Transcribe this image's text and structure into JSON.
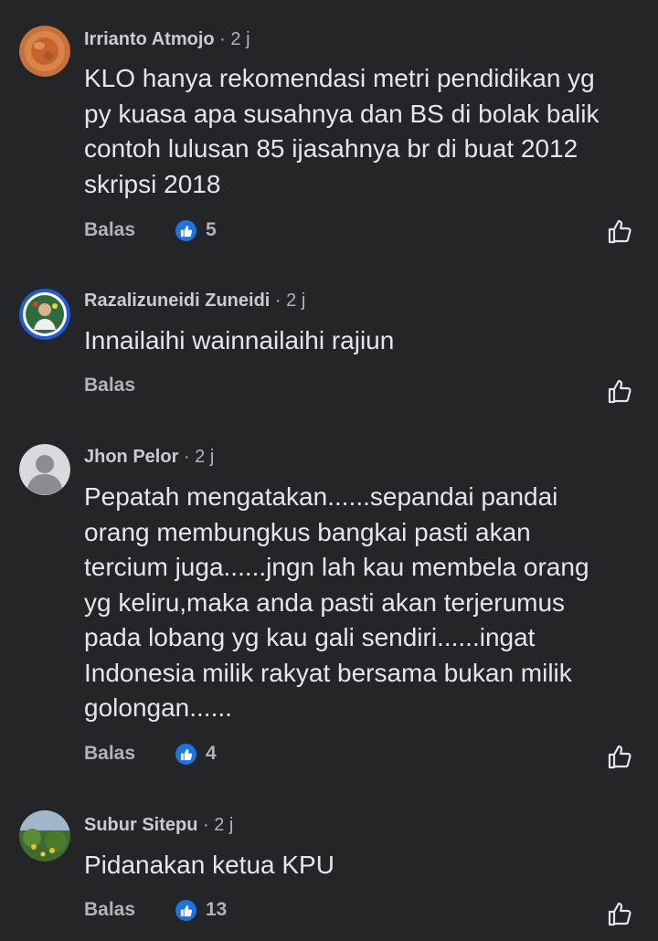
{
  "comments": [
    {
      "author": "Irrianto Atmojo",
      "time": "2 j",
      "text": "KLO hanya rekomendasi metri pendidikan yg\npy kuasa apa susahnya dan BS di bolak balik\ncontoh lulusan 85 ijasahnya br di buat 2012\nskripsi 2018",
      "reply_label": "Balas",
      "reactions": "5"
    },
    {
      "author": "Razalizuneidi Zuneidi",
      "time": "2 j",
      "text": "Innailaihi wainnailaihi rajiun",
      "reply_label": "Balas",
      "reactions": ""
    },
    {
      "author": "Jhon Pelor",
      "time": "2 j",
      "text": "Pepatah mengatakan......sepandai pandai\norang membungkus bangkai pasti akan\ntercium juga......jngn lah kau membela orang\nyg keliru,maka anda pasti akan terjerumus\npada lobang yg kau gali sendiri......ingat\nIndonesia milik rakyat bersama bukan milik\ngolongan......",
      "reply_label": "Balas",
      "reactions": "4"
    },
    {
      "author": "Subur Sitepu",
      "time": "2 j",
      "text": "Pidanakan ketua KPU",
      "reply_label": "Balas",
      "reactions": "13"
    }
  ],
  "separator": "·",
  "icons": {
    "reaction_badge": "like-reaction-icon",
    "like_action": "thumbs-up-outline-icon"
  },
  "colors": {
    "background": "#242526",
    "text": "#e4e6eb",
    "muted": "#b0b3b8",
    "like_blue": "#1a73e8"
  }
}
